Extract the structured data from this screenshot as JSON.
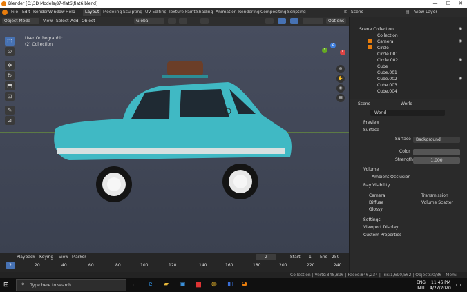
{
  "window": {
    "title": "Blender [C:\\3D Models\\87-fiat6\\fiat6.blend]",
    "minimize": "—",
    "maximize": "☐",
    "close": "✕"
  },
  "menu": [
    "File",
    "Edit",
    "Render",
    "Window",
    "Help"
  ],
  "workspaces": [
    "Layout",
    "Modeling",
    "Sculpting",
    "UV Editing",
    "Texture Paint",
    "Shading",
    "Animation",
    "Rendering",
    "Compositing",
    "Scripting"
  ],
  "topright": {
    "scene": "Scene",
    "view_layer": "View Layer"
  },
  "viewport_header": {
    "mode": "Object Mode",
    "view": "View",
    "select": "Select",
    "add": "Add",
    "object": "Object",
    "orientation": "Global",
    "options": "Options"
  },
  "viewport_info": {
    "view_name": "User Orthographic",
    "collection": "(2) Collection"
  },
  "axes": {
    "x": "X",
    "y": "Y",
    "z": "Z"
  },
  "outliner": {
    "root": "Scene Collection",
    "items": [
      "Collection",
      "Camera",
      "Circle",
      "Circle.001",
      "Circle.002",
      "Cube",
      "Cube.001",
      "Cube.002",
      "Cube.003",
      "Cube.004"
    ]
  },
  "properties": {
    "scene_tab": "Scene",
    "world_tab": "World",
    "world_name": "World",
    "panels": {
      "preview": "Preview",
      "surface": "Surface",
      "volume": "Volume",
      "ambient_occlusion": "Ambient Occlusion",
      "ray_visibility": "Ray Visibility",
      "settings": "Settings",
      "viewport_display": "Viewport Display",
      "custom_properties": "Custom Properties"
    },
    "surface_label": "Surface",
    "surface_value": "Background",
    "color_label": "Color",
    "strength_label": "Strength",
    "strength_value": "1.000",
    "ray": {
      "camera": "Camera",
      "transmission": "Transmission",
      "diffuse": "Diffuse",
      "volume_scatter": "Volume Scatter",
      "glossy": "Glossy"
    },
    "colors": {
      "world_color": "#555555"
    }
  },
  "timeline": {
    "playback": "Playback",
    "keying": "Keying",
    "view": "View",
    "marker": "Marker",
    "current_frame": "2",
    "start_label": "Start",
    "start": "1",
    "end_label": "End",
    "end": "250",
    "ticks": [
      "2",
      "20",
      "40",
      "60",
      "80",
      "100",
      "120",
      "140",
      "160",
      "180",
      "200",
      "220",
      "240"
    ]
  },
  "status": {
    "stats": "Collection | Verts:848,896 | Faces:846,234 | Tris:1,690,562 | Objects:0/36 | Mem: 166.3 MiB | v2.82.7"
  },
  "taskbar": {
    "search": "Type here to search",
    "lang": "ENG",
    "lang2": "INTL",
    "time": "11:46 PM",
    "date": "4/27/2020"
  },
  "colors": {
    "accent": "#4772b3",
    "blender_orange": "#e87d0d",
    "car_teal": "#40b9c4"
  }
}
